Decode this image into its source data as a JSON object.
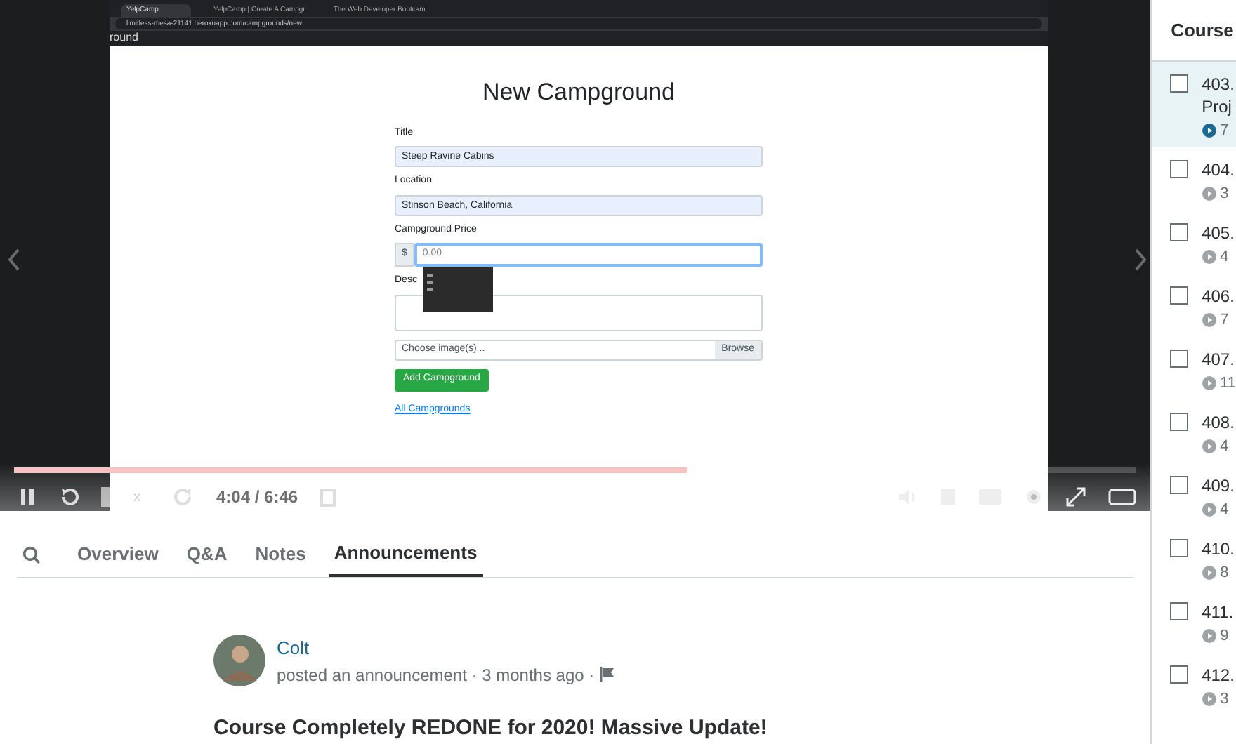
{
  "video": {
    "browser": {
      "tabs": [
        {
          "label": "YelpCamp",
          "selected": true
        },
        {
          "label": "YelpCamp | Create A Campgr",
          "selected": false
        },
        {
          "label": "The Web Developer Bootcam",
          "selected": false
        }
      ],
      "url": "limitless-mesa-21141.herokuapp.com/campgrounds/new",
      "page_fragment": "round"
    },
    "form": {
      "heading": "New Campground",
      "fields": [
        {
          "label": "Title",
          "value": "Steep Ravine Cabins"
        },
        {
          "label": "Location",
          "value": "Stinson Beach, California"
        }
      ],
      "price": {
        "label": "Campground Price",
        "prefix": "$",
        "placeholder": "0.00"
      },
      "description": {
        "label": "Desc"
      },
      "file": {
        "placeholder": "Choose image(s)...",
        "button": "Browse"
      },
      "submit": "Add Campground",
      "link": "All Campgrounds"
    },
    "controls": {
      "progress": {
        "level": 0.6
      },
      "speed": "x",
      "time": "4:04 / 6:46"
    }
  },
  "tabs": [
    {
      "label": "Overview",
      "selected": false
    },
    {
      "label": "Q&A",
      "selected": false
    },
    {
      "label": "Notes",
      "selected": false
    },
    {
      "label": "Announcements",
      "selected": true
    }
  ],
  "announcement": {
    "author": "Colt",
    "meta": "posted an announcement · 3 months ago ·",
    "title": "Course Completely REDONE for 2020! Massive Update!"
  },
  "sidebar": {
    "title": "Course",
    "items": [
      {
        "number": "403.",
        "title": "Proj",
        "duration": "7",
        "selected": true,
        "checked": false
      },
      {
        "number": "404.",
        "duration": "3",
        "selected": false,
        "checked": false
      },
      {
        "number": "405.",
        "duration": "4",
        "selected": false,
        "checked": false
      },
      {
        "number": "406.",
        "duration": "7",
        "selected": false,
        "checked": false
      },
      {
        "number": "407.",
        "duration": "11",
        "selected": false,
        "checked": false
      },
      {
        "number": "408.",
        "duration": "4",
        "selected": false,
        "checked": false
      },
      {
        "number": "409.",
        "duration": "4",
        "selected": false,
        "checked": false
      },
      {
        "number": "410.",
        "duration": "8",
        "selected": false,
        "checked": false
      },
      {
        "number": "411.",
        "duration": "9",
        "selected": false,
        "checked": false
      },
      {
        "number": "412.",
        "duration": "3",
        "selected": false,
        "checked": false
      }
    ]
  }
}
